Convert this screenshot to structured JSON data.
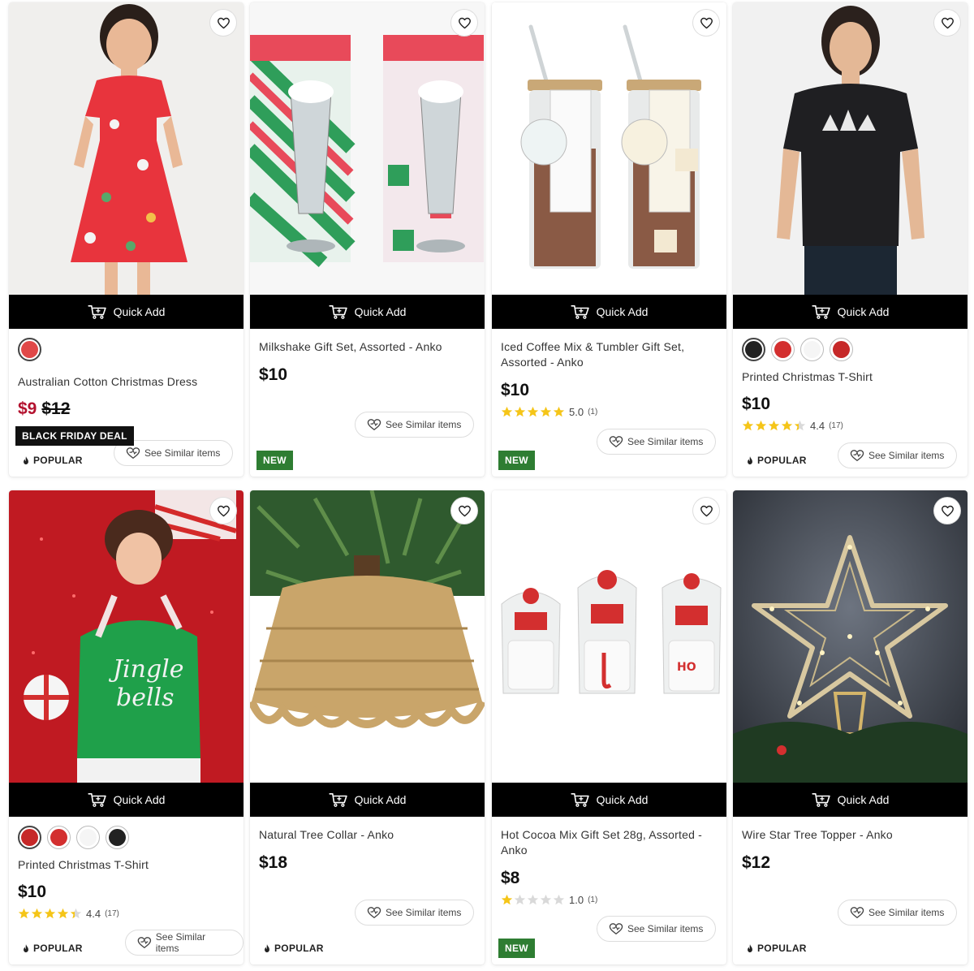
{
  "colors": {
    "accent_sale": "#b3112e",
    "new_badge": "#2e7d32",
    "star": "#f5c518"
  },
  "quick_add_label": "Quick Add",
  "see_similar_label": "See Similar items",
  "products": [
    {
      "name": "Australian Cotton Christmas Dress",
      "price": "$9",
      "was_price": "$12",
      "badges": [
        "BLACK FRIDAY DEAL",
        "POPULAR"
      ],
      "swatches": [
        "#e04848"
      ]
    },
    {
      "name": "Milkshake Gift Set, Assorted - Anko",
      "price": "$10",
      "badges": [
        "NEW"
      ]
    },
    {
      "name": "Iced Coffee Mix & Tumbler Gift Set, Assorted - Anko",
      "price": "$10",
      "badges": [
        "NEW"
      ],
      "rating": "5.0",
      "rating_count": "(1)",
      "stars": 5
    },
    {
      "name": "Printed Christmas T-Shirt",
      "price": "$10",
      "badges": [
        "POPULAR"
      ],
      "swatches": [
        "#222222",
        "#d32f2f",
        "#f5f5f5",
        "#c62828"
      ],
      "rating": "4.4",
      "rating_count": "(17)",
      "stars": 4.4
    },
    {
      "name": "Printed Christmas T-Shirt",
      "price": "$10",
      "badges": [
        "POPULAR"
      ],
      "swatches": [
        "#c62828",
        "#d32f2f",
        "#f5f5f5",
        "#222222"
      ],
      "rating": "4.4",
      "rating_count": "(17)",
      "stars": 4.4
    },
    {
      "name": "Natural Tree Collar - Anko",
      "price": "$18",
      "badges": [
        "POPULAR"
      ]
    },
    {
      "name": "Hot Cocoa Mix Gift Set 28g, Assorted - Anko",
      "price": "$8",
      "badges": [
        "NEW"
      ],
      "rating": "1.0",
      "rating_count": "(1)",
      "stars": 1
    },
    {
      "name": "Wire Star Tree Topper - Anko",
      "price": "$12",
      "badges": [
        "POPULAR"
      ]
    }
  ]
}
